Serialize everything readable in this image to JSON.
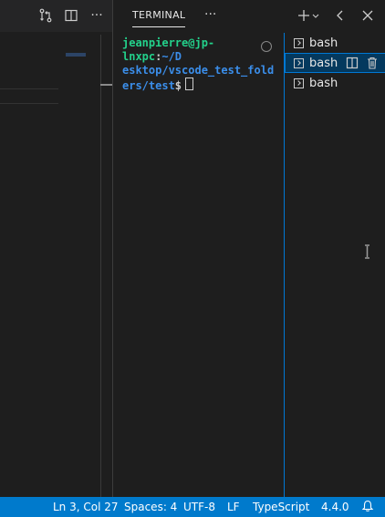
{
  "panel": {
    "tab_label": "TERMINAL",
    "more_label": "···"
  },
  "terminal": {
    "user_host": "jeanpierre@jp-lnxpc",
    "colon": ":",
    "path_line1": "~/D",
    "path_line2": "esktop/vscode_test_fold",
    "path_line3": "ers/test",
    "prompt": "$"
  },
  "terminal_list": {
    "items": [
      {
        "label": "bash"
      },
      {
        "label": "bash"
      },
      {
        "label": "bash"
      }
    ]
  },
  "editor": {
    "more_label": "···"
  },
  "status_bar": {
    "position": "Ln 3, Col 27",
    "indent": "Spaces: 4",
    "encoding": "UTF-8",
    "eol": "LF",
    "language": "TypeScript",
    "version": "4.4.0"
  },
  "colors": {
    "status_bar_bg": "#007acc",
    "active_item_bg": "#04395e",
    "focus_border": "#0078d4",
    "prompt_user": "#23d18b",
    "prompt_path": "#3b8eea"
  }
}
